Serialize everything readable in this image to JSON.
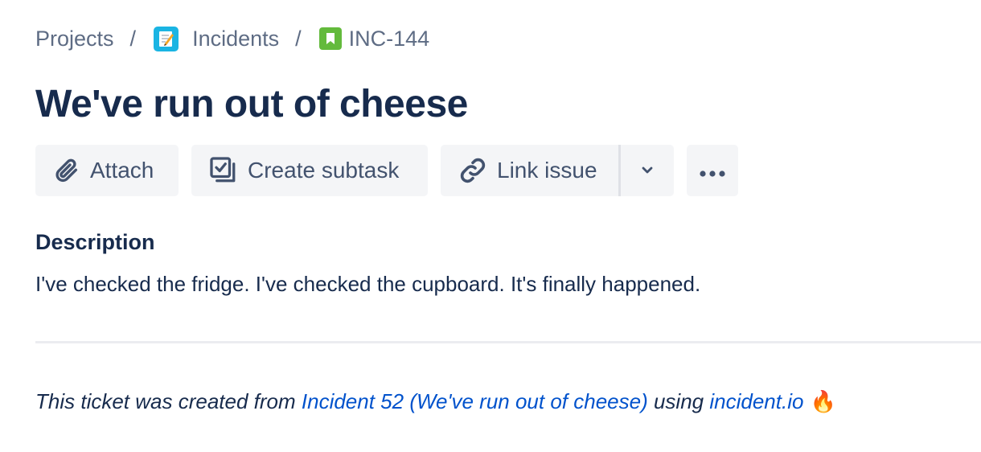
{
  "breadcrumb": {
    "projects": "Projects",
    "separator": "/",
    "project": "Incidents",
    "issue_key": "INC-144"
  },
  "title": "We've run out of cheese",
  "toolbar": {
    "attach": "Attach",
    "create_subtask": "Create subtask",
    "link_issue": "Link issue"
  },
  "description": {
    "heading": "Description",
    "text": "I've checked the fridge. I've checked the cupboard. It's finally happened."
  },
  "footer": {
    "prefix": "This ticket was created from",
    "incident_link": "Incident 52 (We've run out of cheese)",
    "middle": "using",
    "site_link": "incident.io",
    "emoji": "🔥"
  },
  "colors": {
    "text": "#172b4d",
    "muted": "#5e6c84",
    "link": "#0052cc",
    "button_bg": "#f4f5f7",
    "project_icon": "#1ab4e3",
    "issue_icon": "#63ba3c"
  },
  "icons": [
    "memo-icon",
    "bookmark-icon",
    "paperclip-icon",
    "subtask-icon",
    "link-icon",
    "chevron-down-icon",
    "more-icon",
    "fire-emoji"
  ]
}
